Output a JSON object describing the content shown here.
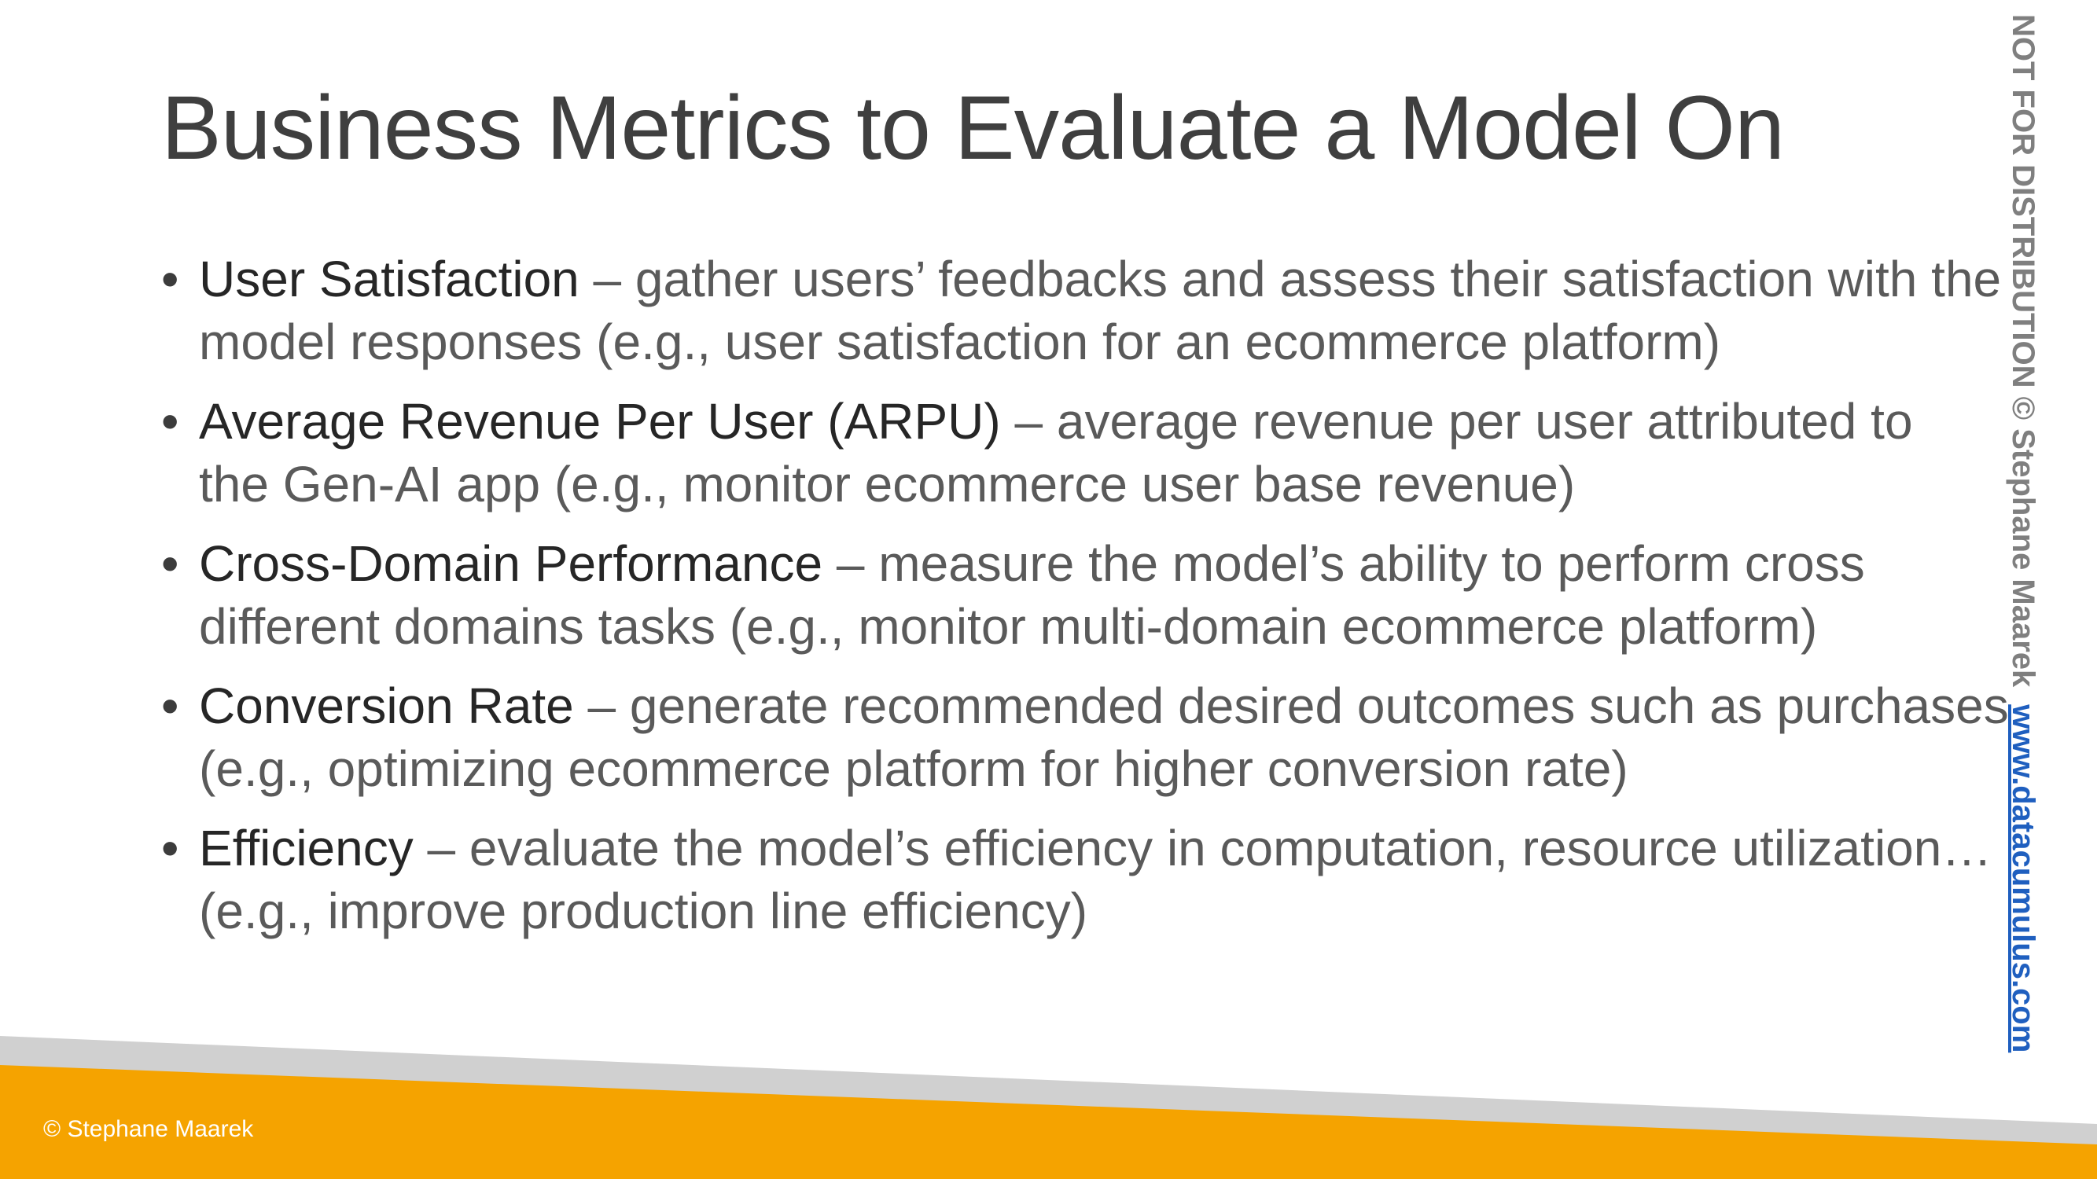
{
  "title": "Business Metrics to Evaluate a Model On",
  "bullet_symbol": "•",
  "bullets": [
    {
      "term": "User Satisfaction",
      "line1": " – gather users’ feedbacks and assess their satisfaction with the",
      "line2": "model responses (e.g., user satisfaction for an ecommerce platform)"
    },
    {
      "term": "Average Revenue Per User (ARPU)",
      "line1": " – average revenue per user attributed to",
      "line2": "the Gen-AI app (e.g., monitor ecommerce user base revenue)"
    },
    {
      "term": "Cross-Domain Performance",
      "line1": " – measure the model’s ability to perform cross",
      "line2": "different domains tasks (e.g., monitor multi-domain ecommerce platform)"
    },
    {
      "term": "Conversion Rate",
      "line1": " – generate recommended desired outcomes such as purchases",
      "line2": "(e.g., optimizing ecommerce platform for higher conversion rate)"
    },
    {
      "term": "Efficiency",
      "line1": " – evaluate the model’s efficiency in computation, resource utilization…",
      "line2": "(e.g., improve production line efficiency)"
    }
  ],
  "footer": {
    "copyright": "© Stephane Maarek"
  },
  "side_note": {
    "distribution": "NOT FOR DISTRIBUTION © Stephane Maarek",
    "website": "www.datacumulus.com"
  },
  "colors": {
    "accent_orange": "#f5a300",
    "band_gray": "#d0d0d0",
    "link_blue": "#1f5fbf"
  }
}
